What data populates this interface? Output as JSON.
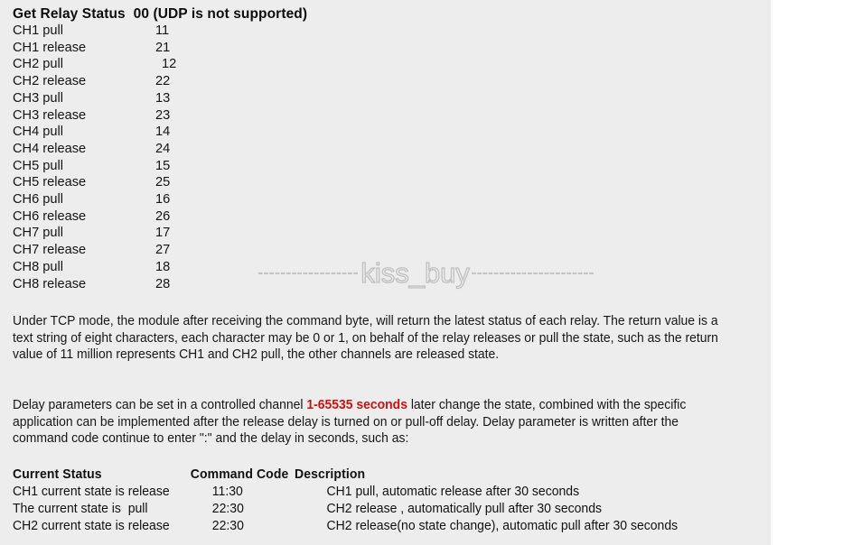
{
  "command_list": {
    "title": "Get Relay Status  00 (UDP is not supported)",
    "rows": [
      {
        "name": "CH1 pull",
        "code": "11"
      },
      {
        "name": "CH1 release",
        "code": "21"
      },
      {
        "name": "CH2 pull",
        "code": "12"
      },
      {
        "name": "CH2 release",
        "code": "22"
      },
      {
        "name": "CH3 pull",
        "code": "13"
      },
      {
        "name": "CH3 release",
        "code": "23"
      },
      {
        "name": "CH4 pull",
        "code": "14"
      },
      {
        "name": "CH4 release",
        "code": "24"
      },
      {
        "name": "CH5 pull",
        "code": "15"
      },
      {
        "name": "CH5 release",
        "code": "25"
      },
      {
        "name": "CH6 pull",
        "code": "16"
      },
      {
        "name": "CH6 release",
        "code": "26"
      },
      {
        "name": "CH7 pull",
        "code": "17"
      },
      {
        "name": "CH7 release",
        "code": "27"
      },
      {
        "name": "CH8 pull",
        "code": "18"
      },
      {
        "name": "CH8 release",
        "code": "28"
      }
    ]
  },
  "watermark": {
    "text": "kiss_buy",
    "dashes_left": "------------------",
    "dashes_right": "----------------------",
    "color": "#c0c0c0"
  },
  "paragraphs": {
    "tcp_mode": "Under TCP mode, the module after receiving the command byte, will return the latest status of each relay. The return value is a text string of eight characters, each character may be 0 or 1, on behalf of the relay releases or pull the state, such as the return value of 11 million represents CH1 and CH2 pull, the other channels are released state.",
    "delay_part1": "Delay parameters can be set in a controlled channel ",
    "delay_highlight": "1-65535 seconds",
    "delay_part2": " later change the state, combined with the specific application can be implemented after the release delay is turned on or pull-off delay. Delay parameter is written after the command code continue to enter \":\" and the delay in seconds, such as:",
    "highlight_color": "#cc1111"
  },
  "status_table": {
    "headers": {
      "status": "Current Status",
      "code": "Command Code",
      "description": "Description"
    },
    "rows": [
      {
        "status": "CH1 current state is release",
        "code": "11:30",
        "description": "CH1 pull, automatic release after 30 seconds"
      },
      {
        "status": "The current state is  pull",
        "code": "22:30",
        "description": "CH2 release , automatically pull after 30 seconds"
      },
      {
        "status": "CH2 current state is release",
        "code": "22:30",
        "description": "CH2 release(no state change), automatic pull after 30 seconds"
      }
    ]
  },
  "theme": {
    "panel_background": "#ededed",
    "page_background": "#ffffff",
    "text_color": "#141414"
  }
}
